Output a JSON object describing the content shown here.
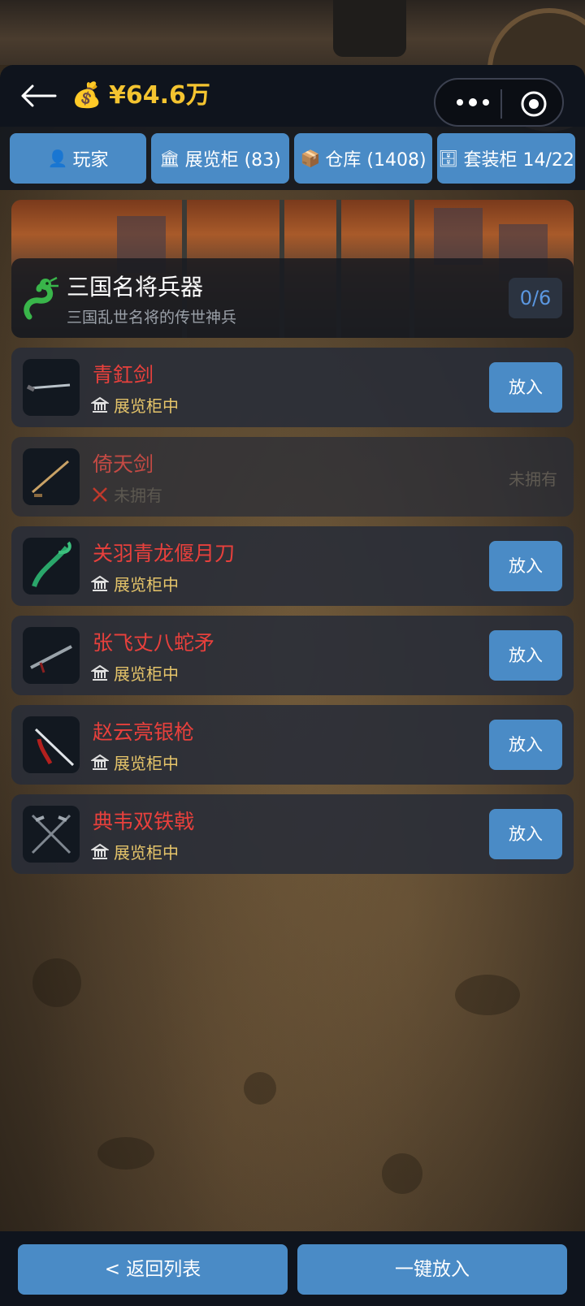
{
  "header": {
    "balance": "¥64.6万",
    "balance_icon": "money-bag-icon"
  },
  "tabs": [
    {
      "icon": "👤",
      "label": "玩家"
    },
    {
      "icon": "🏛",
      "label": "展览柜 (83)"
    },
    {
      "icon": "📦",
      "label": "仓库 (1408)"
    },
    {
      "icon": "🗄",
      "label": "套装柜 14/22"
    }
  ],
  "collection": {
    "title": "三国名将兵器",
    "subtitle": "三国乱世名将的传世神兵",
    "progress": "0/6"
  },
  "items": [
    {
      "name": "青釭剑",
      "status": "展览柜中",
      "owned": true,
      "action": "放入"
    },
    {
      "name": "倚天剑",
      "status": "未拥有",
      "owned": false,
      "action": "未拥有"
    },
    {
      "name": "关羽青龙偃月刀",
      "status": "展览柜中",
      "owned": true,
      "action": "放入"
    },
    {
      "name": "张飞丈八蛇矛",
      "status": "展览柜中",
      "owned": true,
      "action": "放入"
    },
    {
      "name": "赵云亮银枪",
      "status": "展览柜中",
      "owned": true,
      "action": "放入"
    },
    {
      "name": "典韦双铁戟",
      "status": "展览柜中",
      "owned": true,
      "action": "放入"
    }
  ],
  "footer": {
    "back_label": "< 返回列表",
    "put_all_label": "一键放入"
  },
  "colors": {
    "accent": "#4a8bc6",
    "money": "#f4c430",
    "item_name": "#e8403c",
    "status": "#e6c56a"
  }
}
